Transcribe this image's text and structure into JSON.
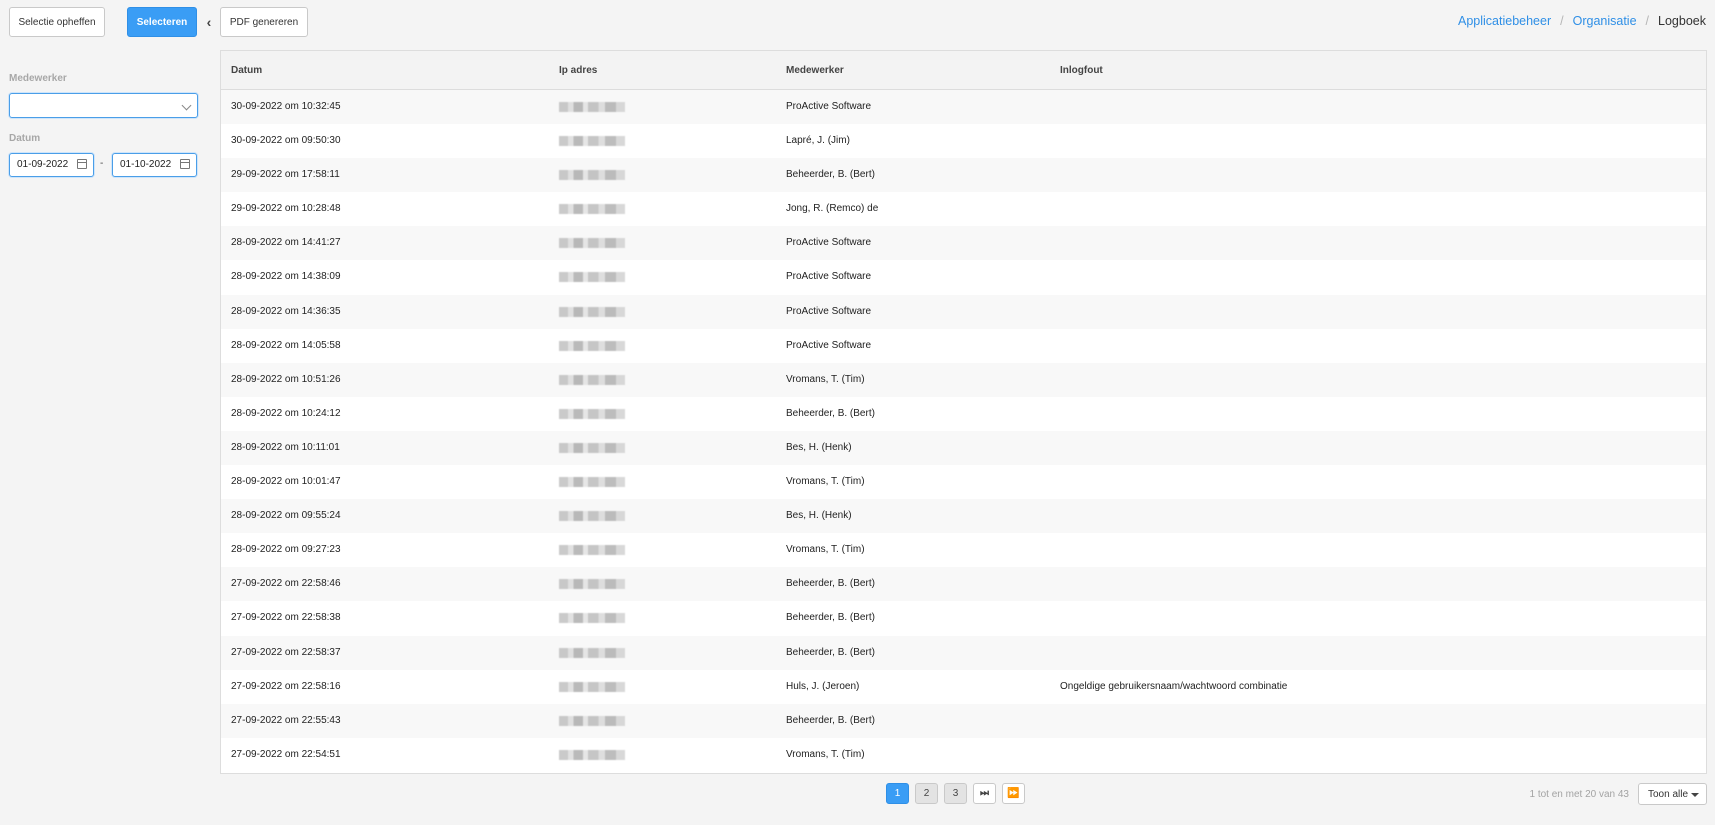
{
  "toolbar": {
    "clear_label": "Selectie opheffen",
    "select_label": "Selecteren",
    "collapse_icon": "chevron-left-icon",
    "pdf_label": "PDF genereren"
  },
  "breadcrumb": {
    "items": [
      "Applicatiebeheer",
      "Organisatie",
      "Logboek"
    ],
    "separator": "/"
  },
  "filters": {
    "employee_label": "Medewerker",
    "employee_value": "",
    "date_label": "Datum",
    "date_from": "01-09-2022",
    "date_to": "01-10-2022",
    "date_separator": "-"
  },
  "table": {
    "columns": [
      "Datum",
      "Ip adres",
      "Medewerker",
      "Inlogfout"
    ],
    "rows": [
      {
        "date": "30-09-2022 om 10:32:45",
        "employee": "ProActive Software",
        "error": ""
      },
      {
        "date": "30-09-2022 om 09:50:30",
        "employee": "Lapré, J. (Jim)",
        "error": ""
      },
      {
        "date": "29-09-2022 om 17:58:11",
        "employee": "Beheerder, B. (Bert)",
        "error": ""
      },
      {
        "date": "29-09-2022 om 10:28:48",
        "employee": "Jong, R. (Remco) de",
        "error": ""
      },
      {
        "date": "28-09-2022 om 14:41:27",
        "employee": "ProActive Software",
        "error": ""
      },
      {
        "date": "28-09-2022 om 14:38:09",
        "employee": "ProActive Software",
        "error": ""
      },
      {
        "date": "28-09-2022 om 14:36:35",
        "employee": "ProActive Software",
        "error": ""
      },
      {
        "date": "28-09-2022 om 14:05:58",
        "employee": "ProActive Software",
        "error": ""
      },
      {
        "date": "28-09-2022 om 10:51:26",
        "employee": "Vromans, T. (Tim)",
        "error": ""
      },
      {
        "date": "28-09-2022 om 10:24:12",
        "employee": "Beheerder, B. (Bert)",
        "error": ""
      },
      {
        "date": "28-09-2022 om 10:11:01",
        "employee": "Bes, H. (Henk)",
        "error": ""
      },
      {
        "date": "28-09-2022 om 10:01:47",
        "employee": "Vromans, T. (Tim)",
        "error": ""
      },
      {
        "date": "28-09-2022 om 09:55:24",
        "employee": "Bes, H. (Henk)",
        "error": ""
      },
      {
        "date": "28-09-2022 om 09:27:23",
        "employee": "Vromans, T. (Tim)",
        "error": ""
      },
      {
        "date": "27-09-2022 om 22:58:46",
        "employee": "Beheerder, B. (Bert)",
        "error": ""
      },
      {
        "date": "27-09-2022 om 22:58:38",
        "employee": "Beheerder, B. (Bert)",
        "error": ""
      },
      {
        "date": "27-09-2022 om 22:58:37",
        "employee": "Beheerder, B. (Bert)",
        "error": ""
      },
      {
        "date": "27-09-2022 om 22:58:16",
        "employee": "Huls, J. (Jeroen)",
        "error": "Ongeldige gebruikersnaam/wachtwoord combinatie"
      },
      {
        "date": "27-09-2022 om 22:55:43",
        "employee": "Beheerder, B. (Bert)",
        "error": ""
      },
      {
        "date": "27-09-2022 om 22:54:51",
        "employee": "Vromans, T. (Tim)",
        "error": ""
      }
    ]
  },
  "pagination": {
    "pages": [
      "1",
      "2",
      "3"
    ],
    "active_page": "1",
    "last_icon": "skip-to-last-icon",
    "fast_forward_icon": "fast-forward-icon",
    "range_text": "1 tot en met 20 van 43",
    "page_size_label": "Toon alle"
  },
  "colors": {
    "accent": "#3a9df5",
    "link": "#2f8fe6"
  }
}
